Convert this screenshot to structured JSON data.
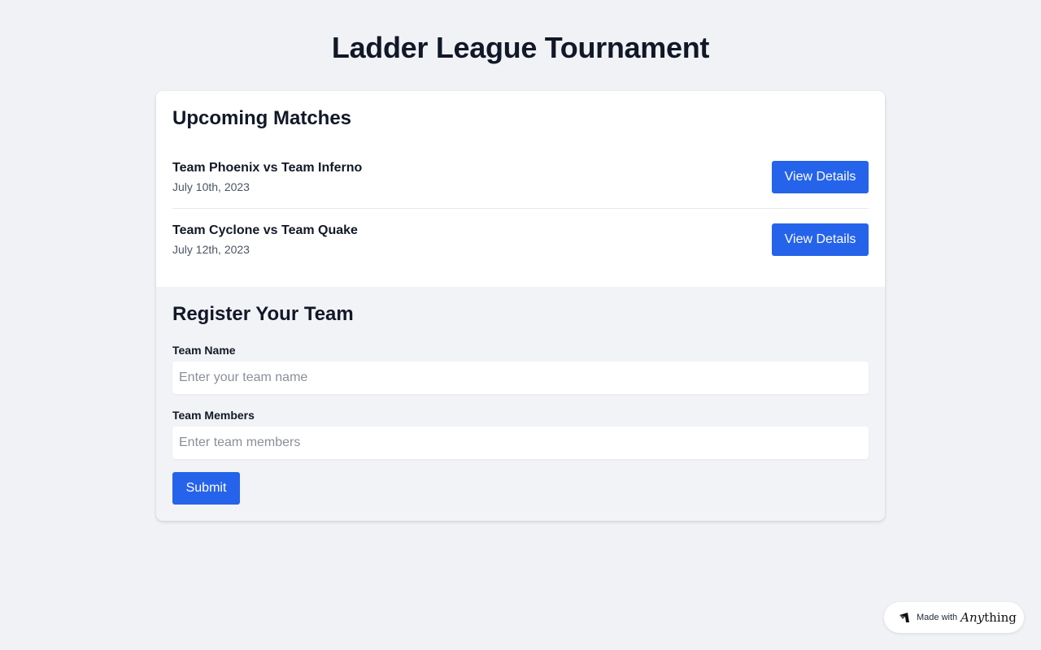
{
  "page": {
    "title": "Ladder League Tournament"
  },
  "matches": {
    "title": "Upcoming Matches",
    "items": [
      {
        "name": "Team Phoenix vs Team Inferno",
        "date": "July 10th, 2023",
        "button": "View Details"
      },
      {
        "name": "Team Cyclone vs Team Quake",
        "date": "July 12th, 2023",
        "button": "View Details"
      }
    ]
  },
  "register": {
    "title": "Register Your Team",
    "team_name_label": "Team Name",
    "team_name_placeholder": "Enter your team name",
    "team_members_label": "Team Members",
    "team_members_placeholder": "Enter team members",
    "submit_label": "Submit"
  },
  "badge": {
    "prefix": "Made with",
    "brand_italic": "Any",
    "brand_rest": "thing"
  },
  "colors": {
    "accent": "#2563eb",
    "background": "#f1f2f5"
  }
}
